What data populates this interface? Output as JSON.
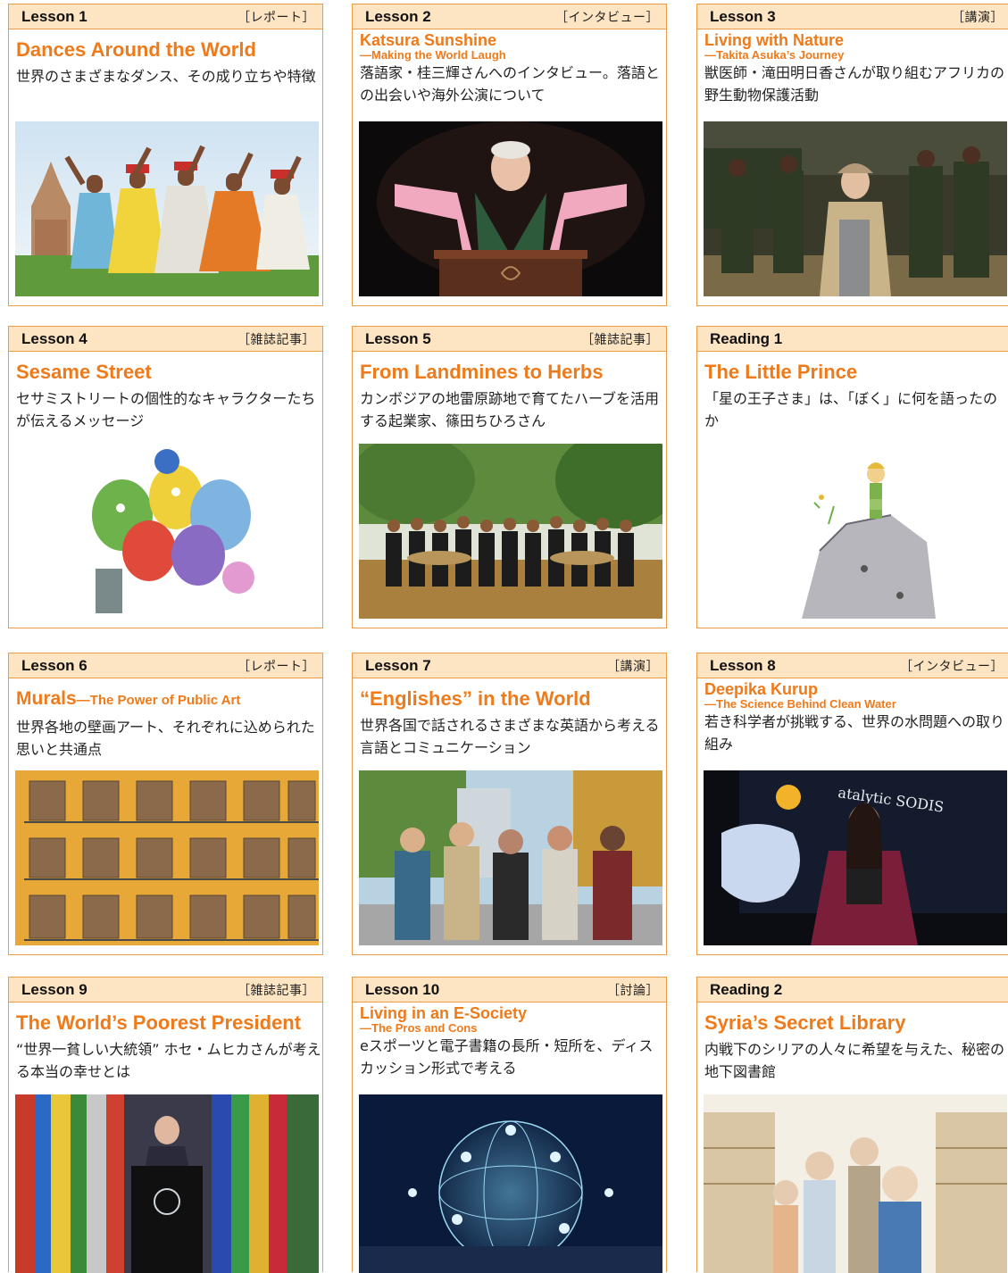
{
  "cards": [
    {
      "lesson": "Lesson 1",
      "kind": "［レポート］",
      "title": "Dances Around the World",
      "desc": "世界のさまざまなダンス、その成り立ちや特徴",
      "photo": "dancers-photo"
    },
    {
      "lesson": "Lesson 2",
      "kind": "［インタビュー］",
      "title": "Katsura Sunshine",
      "subtitle": "—Making the World Laugh",
      "desc": "落語家・桂三輝さんへのインタビュー。落語との出会いや海外公演について",
      "photo": "rakugo-performer-photo"
    },
    {
      "lesson": "Lesson 3",
      "kind": "［講演］",
      "title": "Living with Nature",
      "subtitle": "—Takita Asuka’s Journey",
      "desc": "獣医師・滝田明日香さんが取り組むアフリカの野生動物保護活動",
      "photo": "rangers-photo"
    },
    {
      "lesson": "Lesson 4",
      "kind": "［雑誌記事］",
      "title": "Sesame Street",
      "desc": "セサミストリートの個性的なキャラクターたちが伝えるメッセージ",
      "photo": "muppets-photo"
    },
    {
      "lesson": "Lesson 5",
      "kind": "［雑誌記事］",
      "title": "From Landmines to Herbs",
      "desc": "カンボジアの地雷原跡地で育てたハーブを活用する起業家、篠田ちひろさん",
      "photo": "herb-team-photo"
    },
    {
      "lesson": "Reading 1",
      "kind": "",
      "title": "The Little Prince",
      "desc": "「星の王子さま」は、「ぼく」に何を語ったのか",
      "photo": "little-prince-illustration"
    },
    {
      "lesson": "Lesson 6",
      "kind": "［レポート］",
      "title": "Murals",
      "subtitle": "—The Power of Public Art",
      "desc": "世界各地の壁画アート、それぞれに込められた思いと共通点",
      "photo": "mural-building-photo"
    },
    {
      "lesson": "Lesson 7",
      "kind": "［講演］",
      "title": "“Englishes” in the World",
      "desc": "世界各国で話されるさまざまな英語から考える言語とコミュニケーション",
      "photo": "students-walking-photo"
    },
    {
      "lesson": "Lesson 8",
      "kind": "［インタビュー］",
      "title": "Deepika Kurup",
      "subtitle": "—The Science Behind Clean Water",
      "desc": "若き科学者が挑戦する、世界の水問題への取り組み",
      "photo": "stage-speaker-photo",
      "stage_text": "atalytic SODIS"
    },
    {
      "lesson": "Lesson 9",
      "kind": "［雑誌記事］",
      "title": "The World’s Poorest President",
      "desc": "“世界一貧しい大統領” ホセ・ムヒカさんが考える本当の幸せとは",
      "photo": "president-podium-photo"
    },
    {
      "lesson": "Lesson 10",
      "kind": "［討論］",
      "title": "Living in an E-Society",
      "subtitle": "—The Pros and Cons",
      "desc": "eスポーツと電子書籍の長所・短所を、ディスカッション形式で考える",
      "photo": "digital-network-photo"
    },
    {
      "lesson": "Reading 2",
      "kind": "",
      "title": "Syria’s Secret Library",
      "desc": "内戦下のシリアの人々に希望を与えた、秘密の地下図書館",
      "photo": "library-illustration"
    }
  ]
}
